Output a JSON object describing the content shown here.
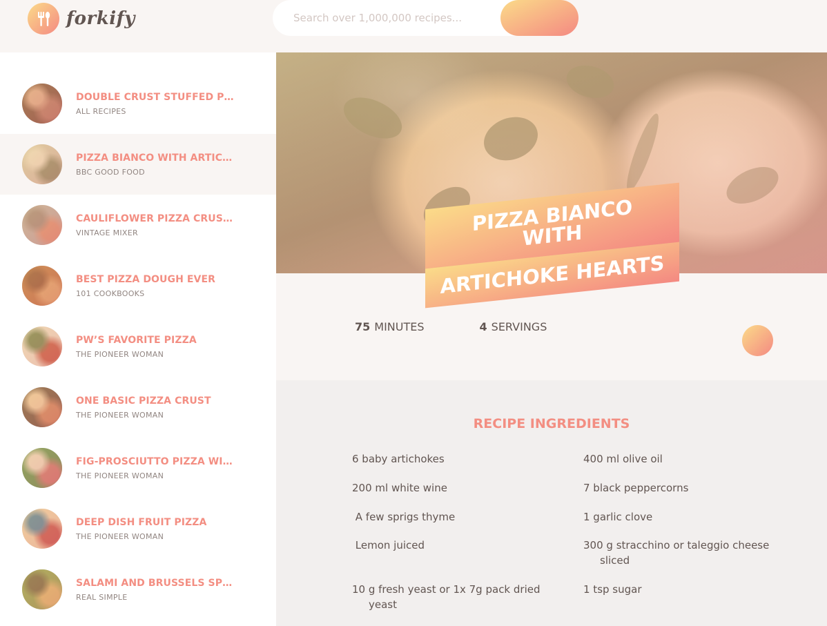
{
  "brand": {
    "name": "forkify"
  },
  "search": {
    "placeholder": "Search over 1,000,000 recipes..."
  },
  "results": [
    {
      "title": "Double Crust Stuffed Pizza",
      "publisher": "All Recipes",
      "thumb": [
        "#7a4a3a",
        "#b07060",
        "#d8a088"
      ]
    },
    {
      "title": "Pizza Bianco with Artichoke Hearts",
      "publisher": "BBC Good Food",
      "thumb": [
        "#cfc2a8",
        "#8a8a66",
        "#e8dcc4"
      ]
    },
    {
      "title": "Cauliflower Pizza Crust Recipe",
      "publisher": "Vintage Mixer",
      "thumb": [
        "#b8a4a0",
        "#d88870",
        "#9a8078"
      ]
    },
    {
      "title": "Best Pizza Dough Ever",
      "publisher": "101 Cookbooks",
      "thumb": [
        "#b86a3e",
        "#d89a66",
        "#8a4a2e"
      ]
    },
    {
      "title": "PW’s Favorite Pizza",
      "publisher": "The Pioneer Woman",
      "thumb": [
        "#e8d8c8",
        "#c05040",
        "#6a7a4a"
      ]
    },
    {
      "title": "One Basic Pizza Crust",
      "publisher": "The Pioneer Woman",
      "thumb": [
        "#6a4a3a",
        "#c87a58",
        "#e8c4a0"
      ]
    },
    {
      "title": "Fig-Prosciutto Pizza with Arugula",
      "publisher": "The Pioneer Woman",
      "thumb": [
        "#5a8a4a",
        "#c86a6a",
        "#e8d0c0"
      ]
    },
    {
      "title": "Deep Dish Fruit Pizza",
      "publisher": "The Pioneer Woman",
      "thumb": [
        "#e8c8a8",
        "#c04848",
        "#4a7a9a"
      ]
    },
    {
      "title": "Salami and Brussels Sprouts Pizza",
      "publisher": "Real Simple",
      "thumb": [
        "#8a9a4a",
        "#d8b068",
        "#6a5a3a"
      ]
    }
  ],
  "recipe": {
    "title_line1": "Pizza Bianco with",
    "title_line2": "Artichoke Hearts",
    "minutes": "75",
    "minutes_label": "minutes",
    "servings": "4",
    "servings_label": "servings",
    "ingredients_heading": "Recipe Ingredients",
    "ingredients": [
      {
        "text": "6 baby artichokes"
      },
      {
        "text": "400 ml olive oil"
      },
      {
        "text": "200 ml white wine"
      },
      {
        "text": "7 black peppercorns"
      },
      {
        "text": " A few sprigs thyme"
      },
      {
        "text": "1 garlic clove"
      },
      {
        "text": " Lemon juiced"
      },
      {
        "text": "300 g stracchino or taleggio cheese",
        "cont": "sliced"
      },
      {
        "text": "10 g fresh yeast or 1x 7g pack dried",
        "cont": "yeast"
      },
      {
        "text": "1 tsp sugar"
      }
    ]
  },
  "colors": {
    "accent": "#f38e82",
    "gradient_start": "#fbdb89",
    "gradient_end": "#f48982",
    "text": "#615551"
  },
  "icons": {
    "logo": "fork-knife-icon"
  }
}
